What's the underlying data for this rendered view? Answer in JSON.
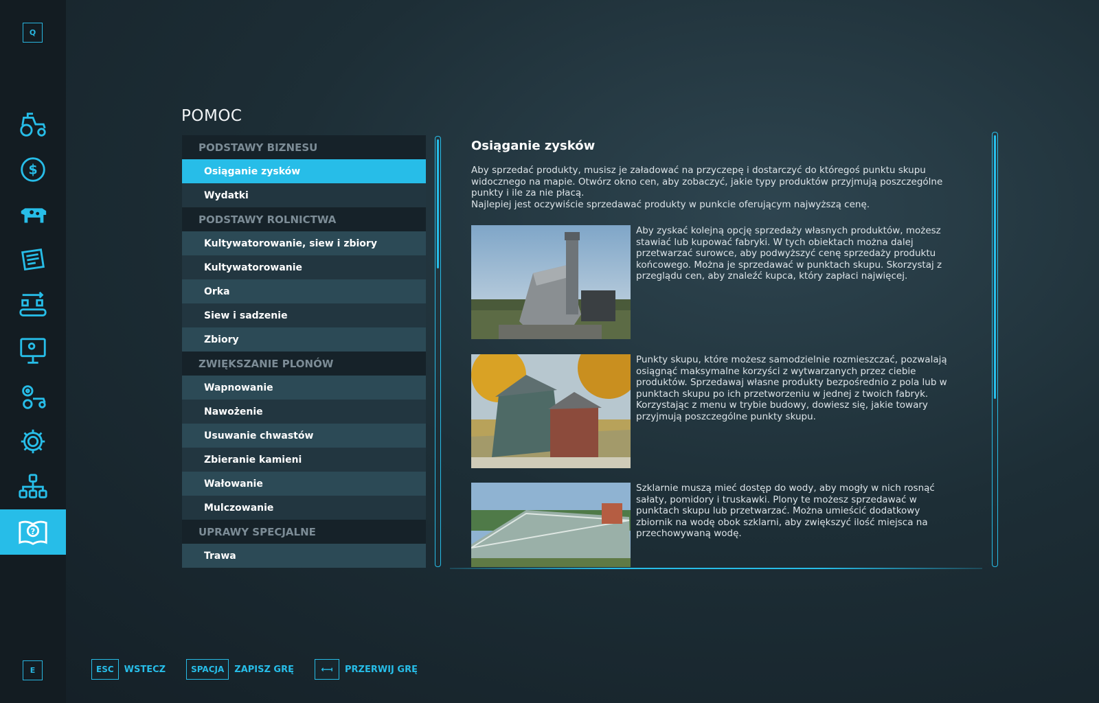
{
  "sidebar": {
    "top_key": "Q",
    "bottom_key": "E",
    "items": [
      {
        "icon": "tractor-icon"
      },
      {
        "icon": "dollar-icon"
      },
      {
        "icon": "cow-icon"
      },
      {
        "icon": "contracts-icon"
      },
      {
        "icon": "production-icon"
      },
      {
        "icon": "presentation-icon"
      },
      {
        "icon": "gear-tractor-icon"
      },
      {
        "icon": "settings-icon"
      },
      {
        "icon": "hierarchy-icon"
      },
      {
        "icon": "help-book-icon"
      }
    ]
  },
  "page": {
    "title": "POMOC"
  },
  "help_list": [
    {
      "type": "category",
      "label": "PODSTAWY BIZNESU"
    },
    {
      "type": "item",
      "label": "Osiąganie zysków",
      "selected": true
    },
    {
      "type": "item",
      "label": "Wydatki"
    },
    {
      "type": "category",
      "label": "PODSTAWY ROLNICTWA"
    },
    {
      "type": "item",
      "label": "Kultywatorowanie, siew i zbiory"
    },
    {
      "type": "item",
      "label": "Kultywatorowanie"
    },
    {
      "type": "item",
      "label": "Orka"
    },
    {
      "type": "item",
      "label": "Siew i sadzenie"
    },
    {
      "type": "item",
      "label": "Zbiory"
    },
    {
      "type": "category",
      "label": "ZWIĘKSZANIE PLONÓW"
    },
    {
      "type": "item",
      "label": "Wapnowanie"
    },
    {
      "type": "item",
      "label": "Nawożenie"
    },
    {
      "type": "item",
      "label": "Usuwanie chwastów"
    },
    {
      "type": "item",
      "label": "Zbieranie kamieni"
    },
    {
      "type": "item",
      "label": "Wałowanie"
    },
    {
      "type": "item",
      "label": "Mulczowanie"
    },
    {
      "type": "category",
      "label": "UPRAWY SPECJALNE"
    },
    {
      "type": "item",
      "label": "Trawa"
    }
  ],
  "content": {
    "title": "Osiąganie zysków",
    "intro_1": "Aby sprzedać produkty, musisz je załadować na przyczepę i dostarczyć do któregoś punktu skupu widocznego na mapie. Otwórz okno cen, aby zobaczyć, jakie typy produktów przyjmują poszczególne punkty i ile za nie płacą.",
    "intro_2": "Najlepiej jest oczywiście sprzedawać produkty w punkcie oferującym najwyższą cenę.",
    "blocks": [
      {
        "text": "Aby zyskać kolejną opcję sprzedaży własnych produktów, możesz stawiać lub kupować fabryki. W tych obiektach można dalej przetwarzać surowce, aby podwyższyć cenę sprzedaży produktu końcowego. Można je sprzedawać w punktach skupu. Skorzystaj z przeglądu cen, aby znaleźć kupca, który zapłaci najwięcej."
      },
      {
        "text": "Punkty skupu, które możesz samodzielnie rozmieszczać, pozwalają osiągnąć maksymalne korzyści z wytwarzanych przez ciebie produktów. Sprzedawaj własne produkty bezpośrednio z pola lub w punktach skupu po ich przetworzeniu w jednej z twoich fabryk. Korzystając z menu w trybie budowy, dowiesz się, jakie towary przyjmują poszczególne punkty skupu."
      },
      {
        "text": "Szklarnie muszą mieć dostęp do wody, aby mogły w nich rosnąć sałaty, pomidory i truskawki. Plony te możesz sprzedawać w punktach skupu lub przetwarzać. Można umieścić dodatkowy zbiornik na wodę obok szklarni, aby zwiększyć ilość miejsca na przechowywaną wodę."
      }
    ]
  },
  "footer": [
    {
      "key": "ESC",
      "label": "WSTECZ"
    },
    {
      "key": "SPACJA",
      "label": "ZAPISZ GRĘ"
    },
    {
      "key": "⟻",
      "label": "PRZERWIJ GRĘ"
    }
  ],
  "colors": {
    "accent": "#27bde8",
    "sidebar": "#131c22",
    "row_dark": "#223640",
    "row_light": "#2c4a56"
  }
}
